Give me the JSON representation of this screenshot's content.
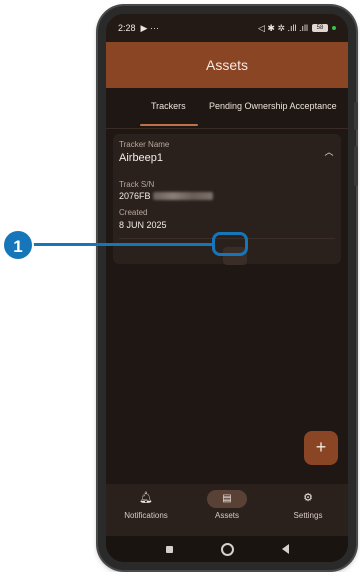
{
  "status_bar": {
    "time": "2:28",
    "left_icons": "▶ ···",
    "right_icons": "◁ ✱ ✲ .ıll .ıll",
    "battery": "58"
  },
  "app_bar": {
    "title": "Assets"
  },
  "tabs": [
    {
      "label": "Trackers",
      "active": true
    },
    {
      "label": "Pending Ownership Acceptance",
      "active": false
    }
  ],
  "tracker_card": {
    "name_label": "Tracker Name",
    "name_value": "Airbeep1",
    "serial_label": "Track S/N",
    "serial_value_visible": "2076FB",
    "created_label": "Created",
    "created_value": "8 JUN 2025",
    "more_label": "···",
    "expand_icon": "chevron-up-icon"
  },
  "fab": {
    "label": "+"
  },
  "bottom_nav": [
    {
      "label": "Notifications",
      "icon": "bell-icon",
      "active": false
    },
    {
      "label": "Assets",
      "icon": "archive-box-icon",
      "active": true
    },
    {
      "label": "Settings",
      "icon": "gear-icon",
      "active": false
    }
  ],
  "callout": {
    "number": "1",
    "color": "#1576b9"
  },
  "colors": {
    "app_bar": "#8a4524",
    "background": "#1f1713",
    "card": "#2a201c",
    "accent": "#c0704a"
  }
}
